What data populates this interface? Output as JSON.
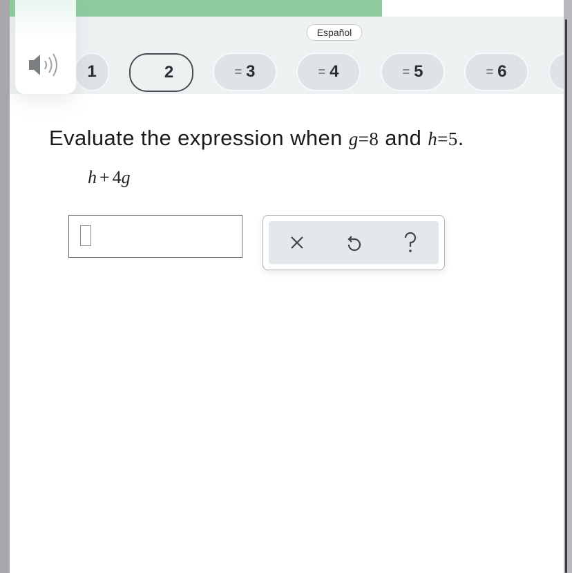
{
  "progress": {
    "completed_fraction": 0.67
  },
  "nav": {
    "espanol_label": "Español",
    "pills": [
      {
        "label": "1"
      },
      {
        "label": "2"
      },
      {
        "label": "3",
        "marker": "="
      },
      {
        "label": "4",
        "marker": "="
      },
      {
        "label": "5",
        "marker": "="
      },
      {
        "label": "6",
        "marker": "="
      },
      {
        "label": "",
        "marker": "="
      }
    ]
  },
  "question": {
    "prefix": "Evaluate the expression when",
    "var1": "g",
    "val1": "8",
    "conjunction": "and",
    "var2": "h",
    "val2": "5",
    "period": ".",
    "expression_var1": "h",
    "expression_op": "+",
    "expression_coeff": "4",
    "expression_var2": "g"
  },
  "answer": {
    "value": ""
  },
  "toolbox": {
    "icons": [
      "clear-icon",
      "undo-icon",
      "help-icon"
    ]
  },
  "colors": {
    "progress": "#8ecb9f",
    "nav_bg": "#eef1f2",
    "pill_bg": "#dde3e6"
  }
}
